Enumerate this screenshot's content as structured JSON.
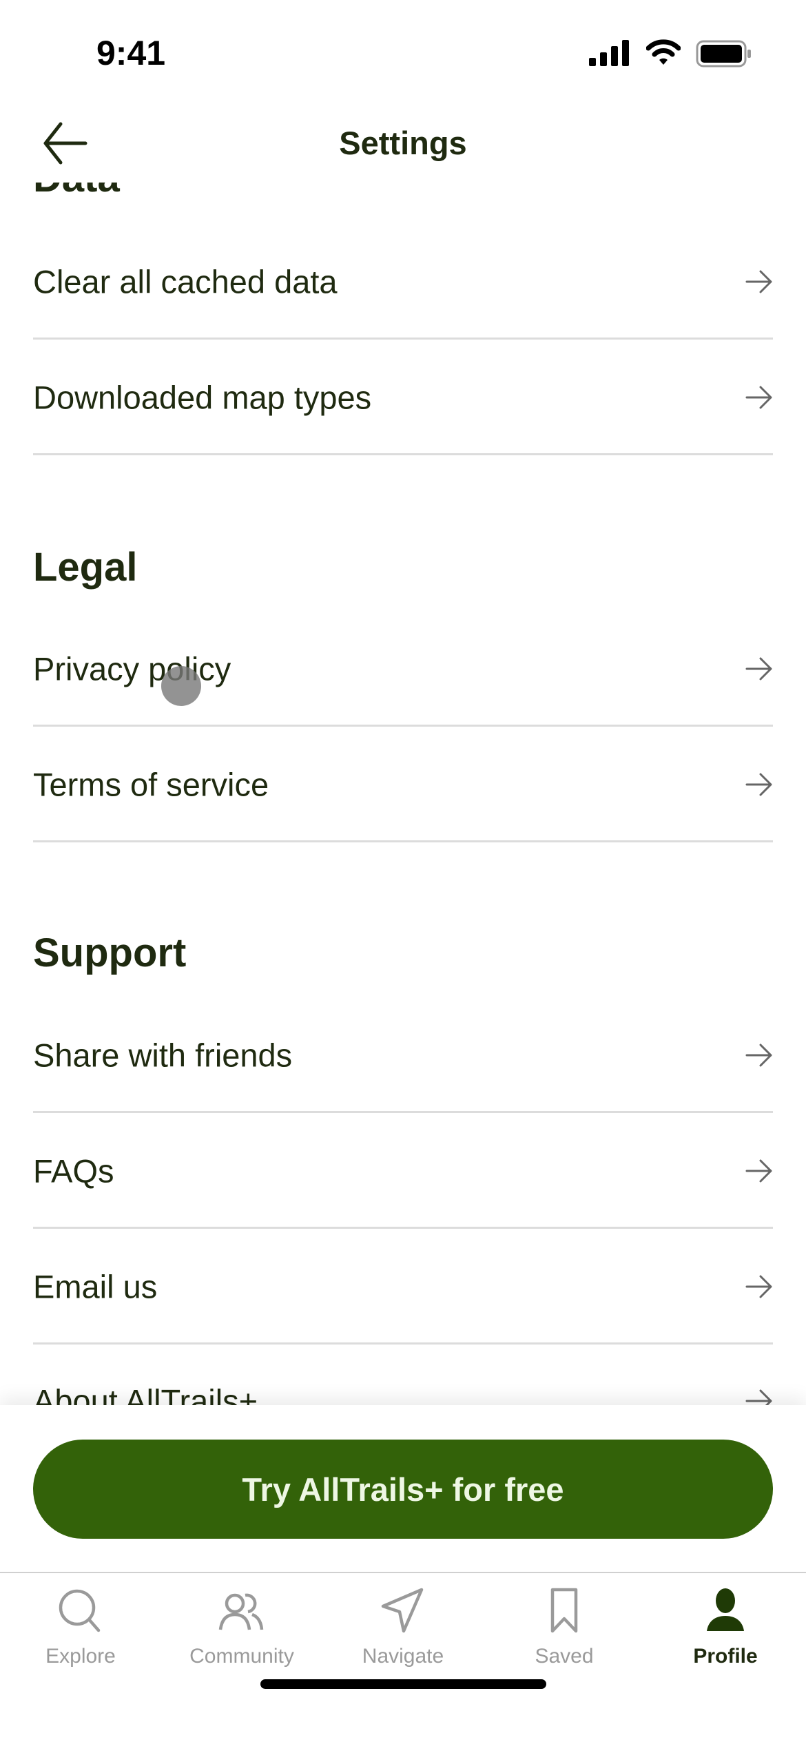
{
  "status_bar": {
    "time": "9:41"
  },
  "header": {
    "title": "Settings"
  },
  "sections": [
    {
      "heading": "Data",
      "items": [
        "Clear all cached data",
        "Downloaded map types"
      ]
    },
    {
      "heading": "Legal",
      "items": [
        "Privacy policy",
        "Terms of service"
      ]
    },
    {
      "heading": "Support",
      "items": [
        "Share with friends",
        "FAQs",
        "Email us",
        "About AllTrails+"
      ]
    }
  ],
  "cta": {
    "label": "Try AllTrails+ for free",
    "color": "#336209"
  },
  "tabs": [
    {
      "label": "Explore",
      "icon": "search-icon"
    },
    {
      "label": "Community",
      "icon": "community-icon"
    },
    {
      "label": "Navigate",
      "icon": "navigate-icon"
    },
    {
      "label": "Saved",
      "icon": "bookmark-icon"
    },
    {
      "label": "Profile",
      "icon": "profile-icon",
      "active": true
    }
  ]
}
